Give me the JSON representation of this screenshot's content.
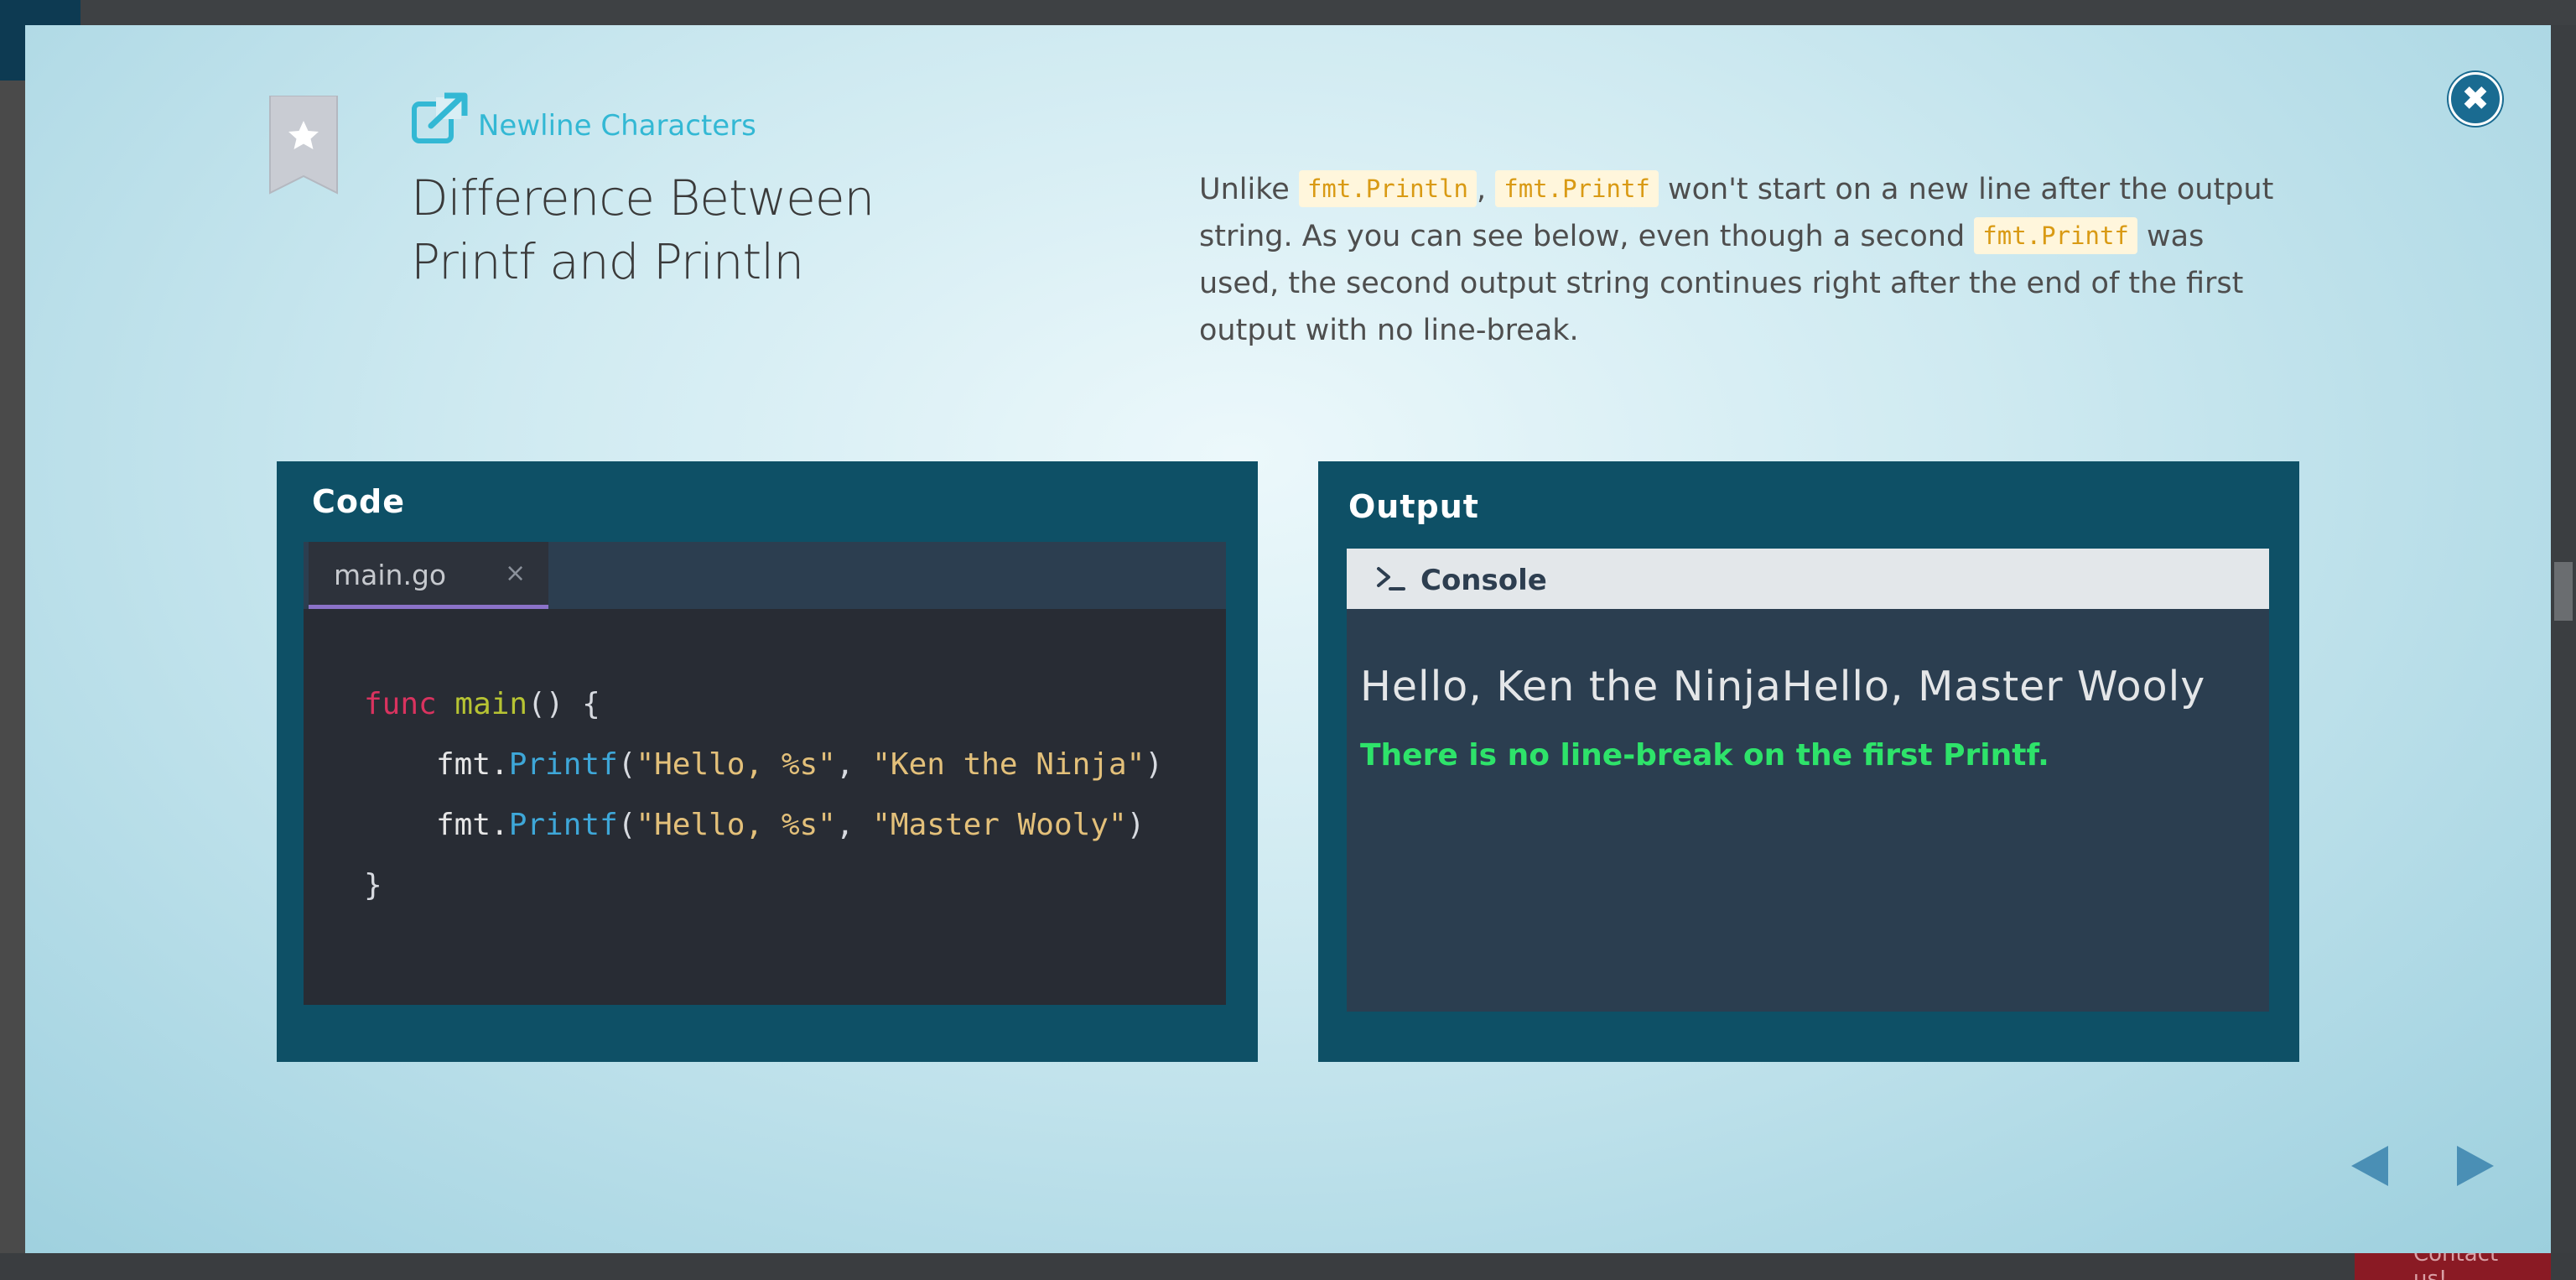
{
  "backdrop": {
    "contact_label": "Contact us!"
  },
  "modal": {
    "topic_label": "Newline Characters",
    "title_line1": "Difference Between",
    "title_line2": "Printf and Println",
    "description": {
      "part1": "Unlike ",
      "chip1": "fmt.Println",
      "part2": ", ",
      "chip2": "fmt.Printf",
      "part3": " won't start on a new line after the output string. As you can see below, even though a second ",
      "chip3": "fmt.Printf",
      "part4": " was used, the second output string continues right after the end of the first output with no line-break."
    },
    "close_icon": "close-icon",
    "colors": {
      "accent": "#33b8d4",
      "panel": "#0e5066",
      "chip_text": "#d99a14",
      "note_green": "#2ee36a"
    }
  },
  "code_panel": {
    "title": "Code",
    "tab_name": "main.go",
    "tab_close": "×",
    "lines": {
      "l1_kw": "func",
      "l1_fn": "main",
      "l1_rest": "() {",
      "l2_pkg": "fmt.",
      "l2_meth": "Printf",
      "l2_open": "(",
      "l2_str1": "\"Hello, %s\"",
      "l2_comma": ", ",
      "l2_str2": "\"Ken the Ninja\"",
      "l2_close": ")",
      "l3_pkg": "fmt.",
      "l3_meth": "Printf",
      "l3_open": "(",
      "l3_str1": "\"Hello, %s\"",
      "l3_comma": ", ",
      "l3_str2": "\"Master Wooly\"",
      "l3_close": ")",
      "l4": "}"
    }
  },
  "output_panel": {
    "title": "Output",
    "console_label": "Console",
    "console_output": "Hello, Ken the NinjaHello, Master Wooly",
    "note": "There is no line-break on the first Printf."
  },
  "navigation": {
    "prev_icon": "triangle-left-icon",
    "next_icon": "triangle-right-icon"
  }
}
